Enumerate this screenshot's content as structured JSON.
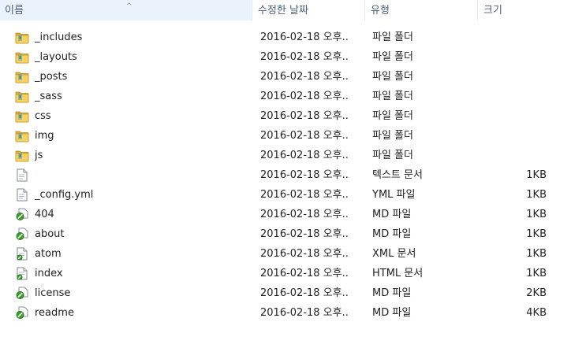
{
  "columns": {
    "name": "이름",
    "date": "수정한 날짜",
    "type": "유형",
    "size": "크기"
  },
  "files": [
    {
      "name": "_includes",
      "date": "2016-02-18 오후...",
      "type": "파일 폴더",
      "size": "",
      "icon": "folder-icon"
    },
    {
      "name": "_layouts",
      "date": "2016-02-18 오후...",
      "type": "파일 폴더",
      "size": "",
      "icon": "folder-icon"
    },
    {
      "name": "_posts",
      "date": "2016-02-18 오후...",
      "type": "파일 폴더",
      "size": "",
      "icon": "folder-icon"
    },
    {
      "name": "_sass",
      "date": "2016-02-18 오후...",
      "type": "파일 폴더",
      "size": "",
      "icon": "folder-icon"
    },
    {
      "name": "css",
      "date": "2016-02-18 오후...",
      "type": "파일 폴더",
      "size": "",
      "icon": "folder-icon"
    },
    {
      "name": "img",
      "date": "2016-02-18 오후...",
      "type": "파일 폴더",
      "size": "",
      "icon": "folder-icon"
    },
    {
      "name": "js",
      "date": "2016-02-18 오후...",
      "type": "파일 폴더",
      "size": "",
      "icon": "folder-icon"
    },
    {
      "name": "",
      "date": "2016-02-18 오후...",
      "type": "텍스트 문서",
      "size": "1KB",
      "icon": "text-file-icon"
    },
    {
      "name": "_config.yml",
      "date": "2016-02-18 오후...",
      "type": "YML 파일",
      "size": "1KB",
      "icon": "text-file-icon"
    },
    {
      "name": "404",
      "date": "2016-02-18 오후...",
      "type": "MD 파일",
      "size": "1KB",
      "icon": "md-file-icon"
    },
    {
      "name": "about",
      "date": "2016-02-18 오후...",
      "type": "MD 파일",
      "size": "1KB",
      "icon": "md-file-icon"
    },
    {
      "name": "atom",
      "date": "2016-02-18 오후...",
      "type": "XML 문서",
      "size": "1KB",
      "icon": "xml-file-icon"
    },
    {
      "name": "index",
      "date": "2016-02-18 오후...",
      "type": "HTML 문서",
      "size": "1KB",
      "icon": "html-file-icon"
    },
    {
      "name": "license",
      "date": "2016-02-18 오후...",
      "type": "MD 파일",
      "size": "2KB",
      "icon": "md-file-icon"
    },
    {
      "name": "readme",
      "date": "2016-02-18 오후...",
      "type": "MD 파일",
      "size": "4KB",
      "icon": "md-file-icon"
    }
  ],
  "colors": {
    "header_text": "#4c607a",
    "folder": "#f4c84a",
    "folder_dark": "#d9a523",
    "editor_green": "#3a9a2a"
  }
}
